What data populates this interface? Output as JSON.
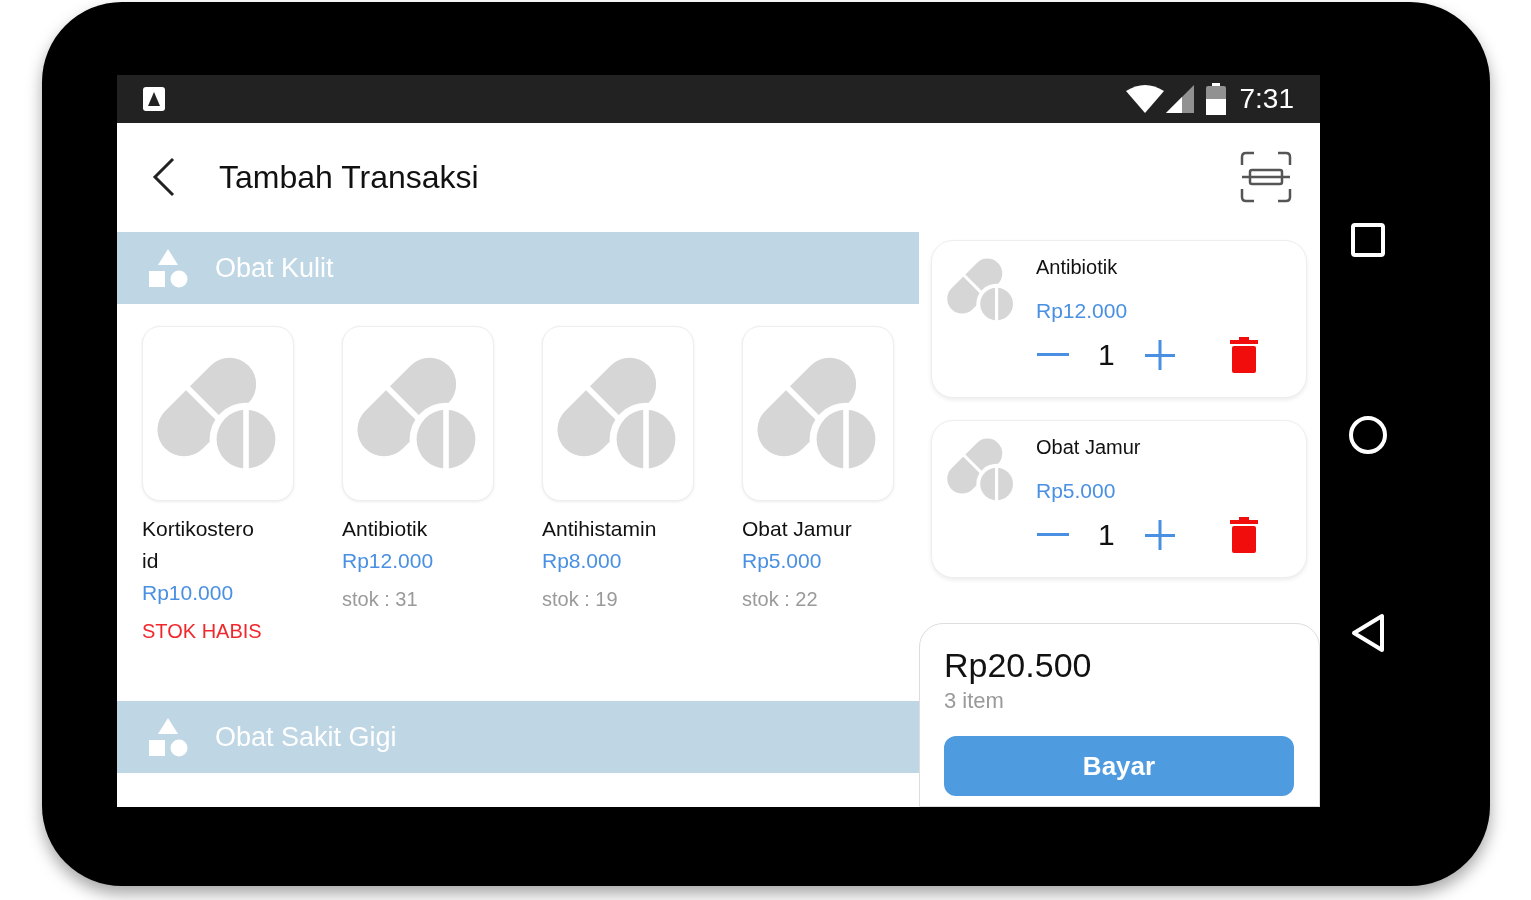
{
  "status_bar": {
    "time": "7:31"
  },
  "header": {
    "title": "Tambah Transaksi"
  },
  "categories": [
    {
      "name": "Obat Kulit",
      "products": [
        {
          "name": "Kortikosteroid",
          "price": "Rp10.000",
          "stock": "STOK HABIS",
          "kind": "out"
        },
        {
          "name": "Antibiotik",
          "price": "Rp12.000",
          "stock": "stok : 31",
          "kind": "available"
        },
        {
          "name": "Antihistamin",
          "price": "Rp8.000",
          "stock": "stok : 19",
          "kind": "available"
        },
        {
          "name": "Obat Jamur",
          "price": "Rp5.000",
          "stock": "stok : 22",
          "kind": "available"
        }
      ]
    },
    {
      "name": "Obat Sakit Gigi"
    }
  ],
  "cart": [
    {
      "name": "Antibiotik",
      "price": "Rp12.000",
      "quantity": "1"
    },
    {
      "name": "Obat Jamur",
      "price": "Rp5.000",
      "quantity": "1"
    }
  ],
  "summary": {
    "total": "Rp20.500",
    "count": "3 item",
    "pay_button": "Bayar"
  }
}
